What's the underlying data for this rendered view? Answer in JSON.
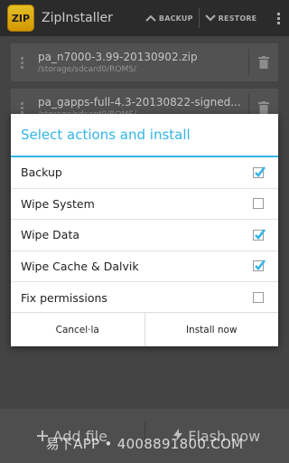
{
  "actionbar": {
    "app_icon_text": "ZIP",
    "title": "ZipInstaller",
    "backup_label": "BACKUP",
    "restore_label": "RESTORE"
  },
  "zip_list": [
    {
      "name": "pa_n7000-3.99-20130902.zip",
      "path": "/storage/sdcard0/ROMS/"
    },
    {
      "name": "pa_gapps-full-4.3-20130822-signed...",
      "path": "/storage/sdcard0/ROMS/"
    }
  ],
  "dialog": {
    "title": "Select actions and install",
    "options": [
      {
        "label": "Backup",
        "checked": true
      },
      {
        "label": "Wipe System",
        "checked": false
      },
      {
        "label": "Wipe Data",
        "checked": true
      },
      {
        "label": "Wipe Cache & Dalvik",
        "checked": true
      },
      {
        "label": "Fix permissions",
        "checked": false
      }
    ],
    "cancel_label": "Cancel·la",
    "install_label": "Install now"
  },
  "bottombar": {
    "add_label": "Add file",
    "flash_label": "Flash now"
  },
  "watermark": "易下APP • 4008891800.COM",
  "colors": {
    "accent": "#33b5e5",
    "actionbar": "#2f2f2f"
  }
}
